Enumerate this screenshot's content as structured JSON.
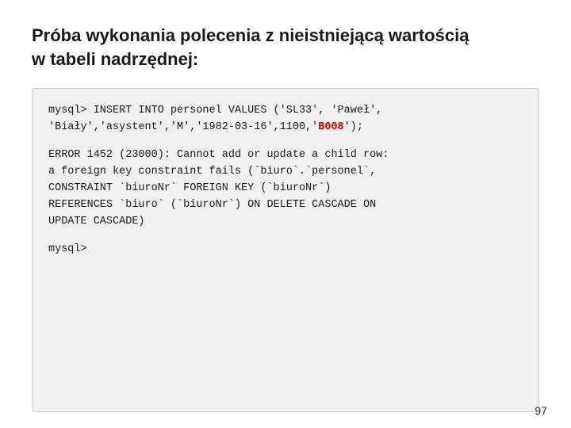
{
  "heading": {
    "line1": "Próba wykonania polecenia z nieistniejącą wartością",
    "line2": "w tabeli nadrzędnej:"
  },
  "code": {
    "block1_line1": "mysql> INSERT INTO personel VALUES ('SL33', 'Paweł',",
    "block1_line2": "'Biały','asystent','M','1982-03-16',1100,",
    "block1_line2_end": ");",
    "block1_highlight": "'B008'",
    "block2_line1": "ERROR 1452 (23000): Cannot add or update a child row:",
    "block2_line2": "a foreign key constraint fails (`biuro`.`personel`,",
    "block2_line3": "CONSTRAINT `biuroNr` FOREIGN KEY (`biuroNr`)",
    "block2_line4": "REFERENCES `biuro` (`biuroNr`) ON DELETE CASCADE ON",
    "block2_line5": "UPDATE CASCADE)",
    "block3_line1": "mysql>"
  },
  "page_number": "97"
}
